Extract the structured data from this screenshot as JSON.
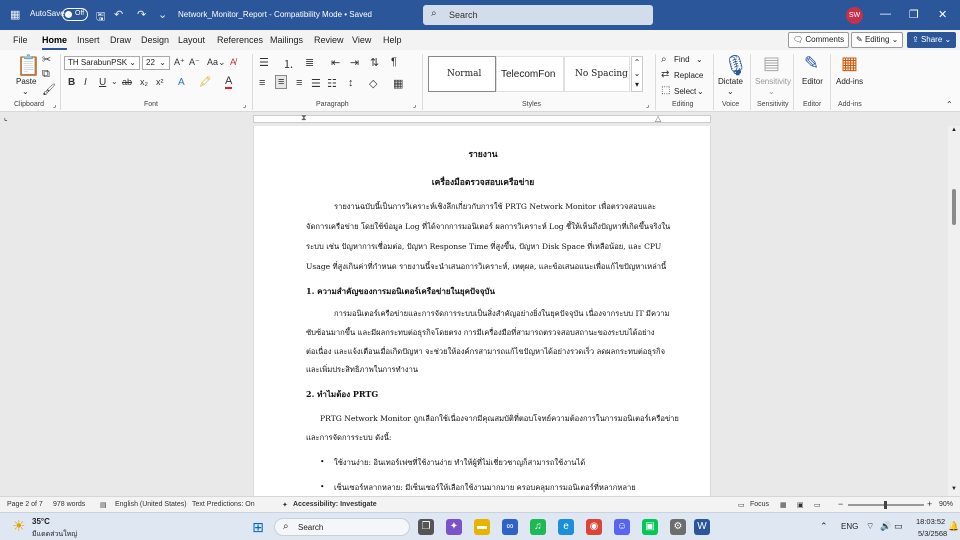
{
  "titlebar": {
    "autosave_label": "AutoSave",
    "autosave_state": "Off",
    "doc_title": "Network_Monitor_Report  -  Compatibility Mode • Saved",
    "search_placeholder": "Search",
    "avatar_initials": "SW"
  },
  "menu": {
    "tabs": [
      "File",
      "Home",
      "Insert",
      "Draw",
      "Design",
      "Layout",
      "References",
      "Mailings",
      "Review",
      "View",
      "Help"
    ],
    "active_tab": "Home",
    "comments_label": "Comments",
    "editing_label": "Editing",
    "share_label": "Share"
  },
  "ribbon": {
    "clipboard": {
      "label": "Clipboard",
      "paste": "Paste"
    },
    "font": {
      "label": "Font",
      "name": "TH SarabunPSK",
      "size": "22"
    },
    "paragraph": {
      "label": "Paragraph"
    },
    "styles": {
      "label": "Styles",
      "items": [
        "Normal",
        "TelecomFon",
        "No Spacing"
      ]
    },
    "editing": {
      "label": "Editing",
      "find": "Find",
      "replace": "Replace",
      "select": "Select"
    },
    "voice": {
      "label": "Voice",
      "dictate": "Dictate"
    },
    "sensitivity": {
      "label": "Sensitivity",
      "btn": "Sensitivity"
    },
    "editor": {
      "label": "Editor",
      "btn": "Editor"
    },
    "addins": {
      "label": "Add-ins",
      "btn": "Add-ins"
    }
  },
  "document": {
    "title1": "รายงาน",
    "title2": "เครื่องมือตรวจสอบเครือข่าย",
    "intro": [
      "รายงานฉบับนี้เป็นการวิเคราะห์เชิงลึกเกี่ยวกับการใช้ PRTG Network Monitor เพื่อตรวจสอบและ",
      "จัดการเครือข่าย โดยใช้ข้อมูล Log ที่ได้จากการมอนิเตอร์ ผลการวิเคราะห์ Log ชี้ให้เห็นถึงปัญหาที่เกิดขึ้นจริงใน",
      "ระบบ เช่น ปัญหาการเชื่อมต่อ, ปัญหา Response Time ที่สูงขึ้น, ปัญหา Disk Space ที่เหลือน้อย, และ CPU",
      "Usage ที่สูงเกินค่าที่กำหนด รายงานนี้จะนำเสนอการวิเคราะห์, เหตุผล, และข้อเสนอแนะเพื่อแก้ไขปัญหาเหล่านี้"
    ],
    "h1": "1. ความสำคัญของการมอนิเตอร์เครือข่ายในยุคปัจจุบัน",
    "p1": [
      "การมอนิเตอร์เครือข่ายและการจัดการระบบเป็นสิ่งสำคัญอย่างยิ่งในยุคปัจจุบัน เนื่องจากระบบ IT มีความ",
      "ซับซ้อนมากขึ้น และมีผลกระทบต่อธุรกิจโดยตรง การมีเครื่องมือที่สามารถตรวจสอบสถานะของระบบได้อย่าง",
      "ต่อเนื่อง และแจ้งเตือนเมื่อเกิดปัญหา จะช่วยให้องค์กรสามารถแก้ไขปัญหาได้อย่างรวดเร็ว ลดผลกระทบต่อธุรกิจ",
      "และเพิ่มประสิทธิภาพในการทำงาน"
    ],
    "h2": "2. ทำไมต้อง PRTG",
    "p2": [
      "PRTG Network Monitor ถูกเลือกใช้เนื่องจากมีคุณสมบัติที่ตอบโจทย์ความต้องการในการมอนิเตอร์เครือข่าย",
      "และการจัดการระบบ ดังนี้:"
    ],
    "bullets": [
      "ใช้งานง่าย: อินเทอร์เฟซที่ใช้งานง่าย ทำให้ผู้ที่ไม่เชี่ยวชาญก็สามารถใช้งานได้",
      "เซ็นเซอร์หลากหลาย: มีเซ็นเซอร์ให้เลือกใช้งานมากมาย ครอบคลุมการมอนิเตอร์ที่หลากหลาย"
    ]
  },
  "status": {
    "page": "Page 2 of 7",
    "words": "978 words",
    "lang": "English (United States)",
    "predictions": "Text Predictions: On",
    "accessibility": "Accessibility: Investigate",
    "focus": "Focus",
    "zoom": "90%"
  },
  "taskbar": {
    "temp": "35°C",
    "weather": "มีแดดส่วนใหญ่",
    "search": "Search",
    "lang": "ENG",
    "time": "18:03:52",
    "date": "5/3/2568"
  },
  "colors": {
    "word_blue": "#2b579a"
  }
}
